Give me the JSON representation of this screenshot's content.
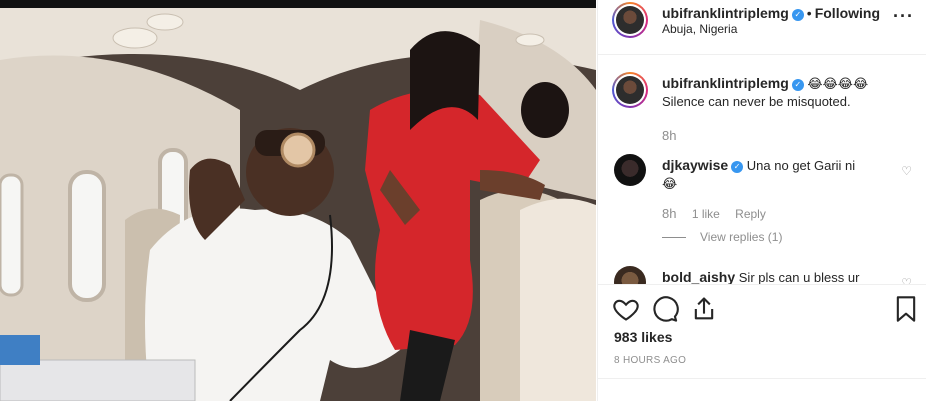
{
  "post": {
    "author": "ubifranklintriplemg",
    "follow_status": "Following",
    "location": "Abuja, Nigeria"
  },
  "comments": [
    {
      "username": "ubifranklintriplemg",
      "emoji": "😂😂😂😂",
      "text": "Silence can never be misquoted.",
      "time": "8h"
    },
    {
      "username": "djkaywise",
      "text": "Una no get Garii ni",
      "emoji": "😂",
      "time": "8h",
      "likes": "1 like",
      "reply_label": "Reply",
      "view_replies": "View replies (1)"
    },
    {
      "username": "bold_aishy",
      "text": "Sir pls can u bless ur"
    }
  ],
  "engagement": {
    "likes": "983 likes",
    "posted_ago": "8 HOURS AGO"
  },
  "icons": {
    "like": "heart-icon",
    "comment": "comment-icon",
    "share": "share-icon",
    "save": "bookmark-icon",
    "more": "more-options-icon",
    "verified": "verified-badge-icon"
  },
  "colors": {
    "verified": "#3897f0",
    "muted": "#8e8e8e",
    "text": "#262626"
  }
}
